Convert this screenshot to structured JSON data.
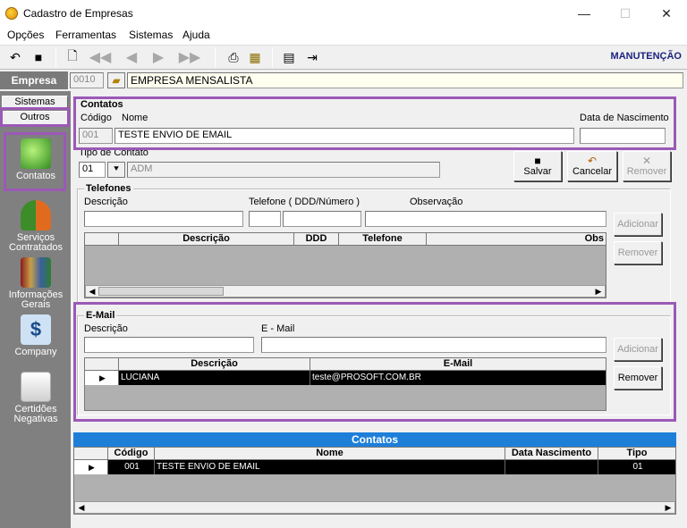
{
  "window": {
    "title": "Cadastro de Empresas",
    "minimize": "—",
    "maximize": "☐",
    "close": "✕"
  },
  "menu": [
    "Opções",
    "Ferramentas",
    "Sistemas",
    "Ajuda"
  ],
  "toolbar": {
    "mode": "MANUTENÇÃO"
  },
  "empresa": {
    "label": "Empresa",
    "code": "0010",
    "name": "EMPRESA MENSALISTA"
  },
  "sidebar": {
    "tabs": [
      "Sistemas",
      "Outros"
    ],
    "items": [
      {
        "label": "Contatos"
      },
      {
        "label": "Serviços Contratados"
      },
      {
        "label": "Informações Gerais"
      },
      {
        "label": "Company"
      },
      {
        "label": "Certidões Negativas"
      }
    ]
  },
  "contatos": {
    "title": "Contatos",
    "codigo_label": "Código",
    "nome_label": "Nome",
    "nascimento_label": "Data de Nascimento",
    "codigo": "001",
    "nome": "TESTE ENVIO DE EMAIL",
    "nascimento": "",
    "tipo_label": "Tipo de Contato",
    "tipo_code": "01",
    "tipo_desc": "ADM"
  },
  "actions": {
    "salvar": "Salvar",
    "cancelar": "Cancelar",
    "remover": "Remover"
  },
  "telefones": {
    "title": "Telefones",
    "descricao_label": "Descrição",
    "telefone_label": "Telefone ( DDD/Número )",
    "obs_label": "Observação",
    "columns": [
      "Descrição",
      "DDD",
      "Telefone",
      "Obs"
    ],
    "adicionar": "Adicionar",
    "remover": "Remover"
  },
  "email": {
    "title": "E-Mail",
    "descricao_label": "Descrição",
    "email_label": "E - Mail",
    "columns": [
      "Descrição",
      "E-Mail"
    ],
    "rows": [
      {
        "descricao": "LUCIANA",
        "email": "teste@PROSOFT.COM.BR"
      }
    ],
    "adicionar": "Adicionar",
    "remover": "Remover"
  },
  "contatos_grid": {
    "title": "Contatos",
    "columns": [
      "Código",
      "Nome",
      "Data Nascimento",
      "Tipo"
    ],
    "rows": [
      {
        "codigo": "001",
        "nome": "TESTE ENVIO DE EMAIL",
        "nascimento": "",
        "tipo": "01"
      }
    ]
  },
  "colors": {
    "accent": "#1e7fd9",
    "highlight": "#9b59b6",
    "sidebar": "#808080"
  }
}
